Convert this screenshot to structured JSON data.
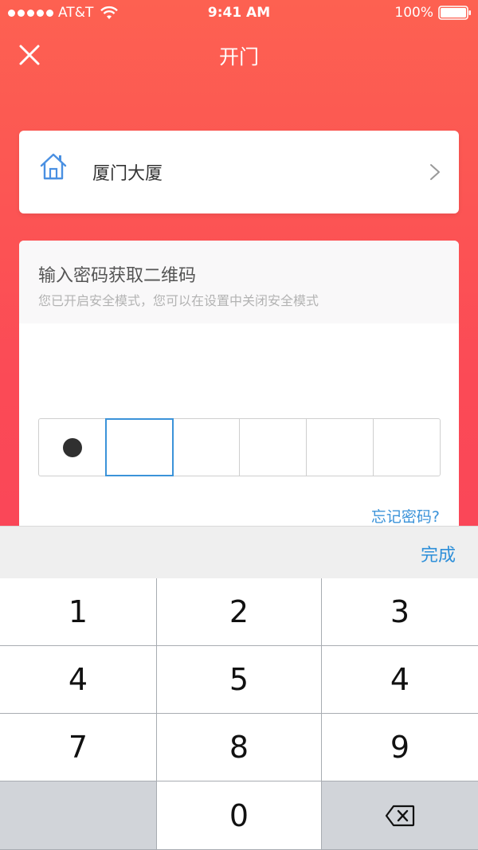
{
  "status_bar": {
    "carrier": "AT&T",
    "time": "9:41 AM",
    "battery": "100%",
    "icons": [
      "signal-dots-icon",
      "wifi-icon",
      "battery-icon"
    ]
  },
  "nav": {
    "title": "开门",
    "close_icon": "close-icon"
  },
  "building": {
    "name": "厦门大厦",
    "icon": "house-icon",
    "chevron_icon": "chevron-right-icon"
  },
  "password": {
    "title": "输入密码获取二维码",
    "subtitle": "您已开启安全模式，您可以在设置中关闭安全模式",
    "digits_total": 6,
    "digits_entered": 1,
    "active_index": 1,
    "forgot_label": "忘记密码?"
  },
  "keyboard": {
    "done_label": "完成",
    "keys": [
      "1",
      "2",
      "3",
      "4",
      "5",
      "4",
      "7",
      "8",
      "9",
      "",
      "0",
      "backspace-icon"
    ]
  },
  "colors": {
    "gradient_top": "#fd6151",
    "gradient_bottom": "#f83f5c",
    "accent_blue": "#3b93d9",
    "house_icon": "#4a90e2"
  }
}
